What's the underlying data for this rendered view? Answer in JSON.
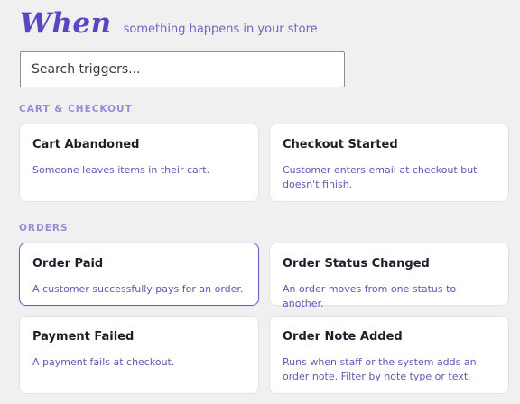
{
  "header": {
    "title": "When",
    "subtitle": "something happens in your store"
  },
  "search": {
    "placeholder": "Search triggers..."
  },
  "sections": [
    {
      "label": "CART & CHECKOUT",
      "cards": [
        {
          "title": "Cart Abandoned",
          "description": "Someone leaves items in their cart."
        },
        {
          "title": "Checkout Started",
          "description": "Customer enters email at checkout but doesn't finish."
        }
      ]
    },
    {
      "label": "ORDERS",
      "cards": [
        {
          "title": "Order Paid",
          "description": "A customer successfully pays for an order.",
          "selected": true
        },
        {
          "title": "Order Status Changed",
          "description": "An order moves from one status to another."
        },
        {
          "title": "Payment Failed",
          "description": "A payment fails at checkout."
        },
        {
          "title": "Order Note Added",
          "description": "Runs when staff or the system adds an order note. Filter by note type or text."
        }
      ]
    }
  ],
  "colors": {
    "accent": "#5b46c2",
    "section_label": "#9a8ccf",
    "description": "#6654b3",
    "selected_border": "#6f5cc7",
    "background": "#f0f0f1"
  }
}
